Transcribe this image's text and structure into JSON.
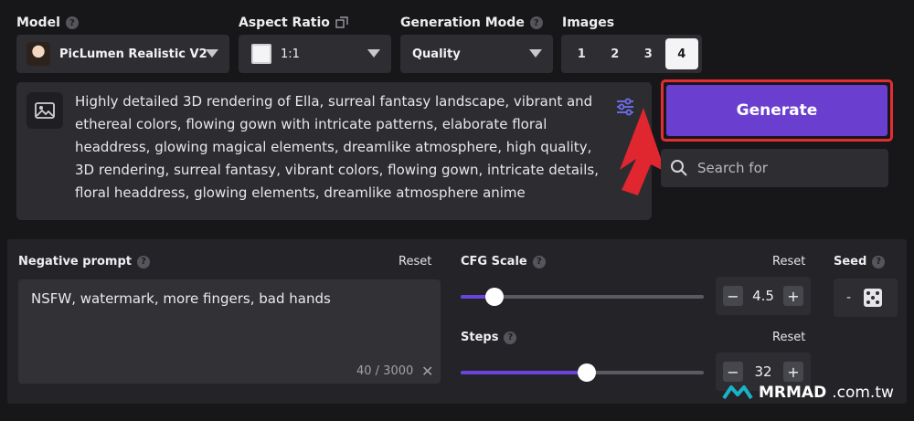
{
  "model": {
    "label": "Model",
    "value": "PicLumen Realistic V2"
  },
  "aspect_ratio": {
    "label": "Aspect Ratio",
    "value": "1:1"
  },
  "generation_mode": {
    "label": "Generation Mode",
    "value": "Quality"
  },
  "images": {
    "label": "Images",
    "options": [
      "1",
      "2",
      "3",
      "4"
    ],
    "selected": "4"
  },
  "prompt": {
    "text": "Highly detailed 3D rendering of Ella, surreal fantasy landscape, vibrant and ethereal colors, flowing gown with intricate patterns, elaborate floral headdress, glowing magical elements, dreamlike atmosphere, high quality, 3D rendering, surreal fantasy, vibrant colors, flowing gown, intricate details, floral headdress, glowing elements, dreamlike atmosphere anime"
  },
  "generate_label": "Generate",
  "search": {
    "placeholder": "Search for"
  },
  "negative_prompt": {
    "label": "Negative prompt",
    "reset": "Reset",
    "value": "NSFW, watermark, more fingers, bad hands",
    "counter": "40 / 3000"
  },
  "cfg_scale": {
    "label": "CFG Scale",
    "reset": "Reset",
    "value": "4.5",
    "slider_fraction": 0.14
  },
  "steps": {
    "label": "Steps",
    "reset": "Reset",
    "value": "32",
    "slider_fraction": 0.52
  },
  "seed": {
    "label": "Seed",
    "value": "-"
  },
  "watermark": {
    "brand": "MRMAD",
    "domain": ".com.tw"
  },
  "colors": {
    "accent": "#6a3fcf",
    "highlight": "#e22e33",
    "background": "#17171a"
  }
}
